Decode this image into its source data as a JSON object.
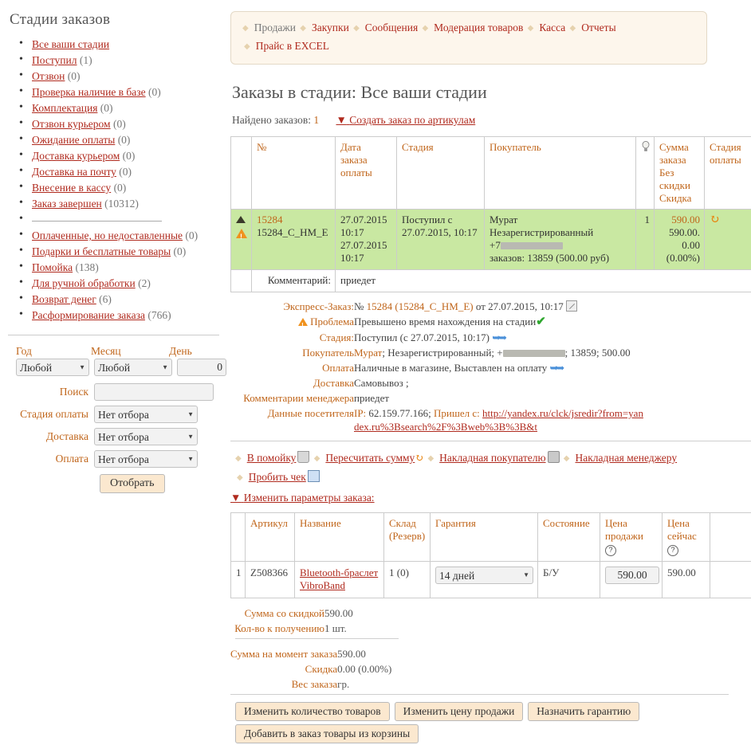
{
  "sidebar": {
    "title": "Стадии заказов",
    "stages": [
      {
        "label": "Все ваши стадии",
        "count": ""
      },
      {
        "label": "Поступил",
        "count": "(1)"
      },
      {
        "label": "Отзвон",
        "count": "(0)"
      },
      {
        "label": "Проверка наличие в базе",
        "count": "(0)"
      },
      {
        "label": "Комплектация",
        "count": "(0)"
      },
      {
        "label": "Отзвон курьером",
        "count": "(0)"
      },
      {
        "label": "Ожидание оплаты",
        "count": "(0)"
      },
      {
        "label": "Доставка курьером",
        "count": "(0)"
      },
      {
        "label": "Доставка на почту",
        "count": "(0)"
      },
      {
        "label": "Внесение в кассу",
        "count": "(0)"
      },
      {
        "label": "Заказ завершен",
        "count": "(10312)"
      }
    ],
    "stages2": [
      {
        "label": "Оплаченные, но недоставленные",
        "count": "(0)"
      },
      {
        "label": "Подарки и бесплатные товары",
        "count": "(0)"
      },
      {
        "label": "Помойка",
        "count": "(138)"
      },
      {
        "label": "Для ручной обработки",
        "count": "(2)"
      },
      {
        "label": "Возврат денег",
        "count": "(6)"
      },
      {
        "label": "Расформирование заказа",
        "count": "(766)"
      }
    ],
    "filter": {
      "year_label": "Год",
      "month_label": "Месяц",
      "day_label": "День",
      "year_value": "Любой",
      "month_value": "Любой",
      "day_value": "0",
      "search_label": "Поиск",
      "search_value": "",
      "search_placeholder": "",
      "pay_stage_label": "Стадия оплаты",
      "pay_stage_value": "Нет отбора",
      "delivery_label": "Доставка",
      "delivery_value": "Нет отбора",
      "payment_label": "Оплата",
      "payment_value": "Нет отбора",
      "submit_label": "Отобрать"
    }
  },
  "topnav": {
    "items": [
      {
        "label": "Продажи",
        "current": true
      },
      {
        "label": "Закупки",
        "current": false
      },
      {
        "label": "Сообщения",
        "current": false
      },
      {
        "label": "Модерация товаров",
        "current": false
      },
      {
        "label": "Касса",
        "current": false
      },
      {
        "label": "Отчеты",
        "current": false
      },
      {
        "label": "Прайс в EXCEL",
        "current": false
      }
    ]
  },
  "main": {
    "page_title": "Заказы в стадии: Все ваши стадии",
    "found_label": "Найдено заказов:",
    "found_count": "1",
    "create_order_link": "Создать заказ по артикулам"
  },
  "orders_table": {
    "headers": {
      "flag": "",
      "num": "№",
      "date": "Дата заказа оплаты",
      "stage": "Стадия",
      "buyer": "Покупатель",
      "bulb": "bulb-icon",
      "sum": "Сумма заказа Без скидки Скидка",
      "pay_stage": "Стадия оплаты"
    },
    "header_lines": {
      "date": [
        "Дата",
        "заказа",
        "оплаты"
      ],
      "sum": [
        "Сумма",
        "заказа",
        "Без",
        "скидки",
        "Скидка"
      ],
      "pay_stage": [
        "Стадия",
        "оплаты"
      ]
    },
    "row": {
      "num": "15284",
      "num_code": "15284_C_HM_E",
      "date_order": "27.07.2015 10:17",
      "date_pay": "27.07.2015 10:17",
      "stage": "Поступил с 27.07.2015, 10:17",
      "buyer_name": "Мурат",
      "buyer_status": "Незарегистрированный",
      "buyer_phone_prefix": "+7",
      "buyer_orders": "заказов: 13859 (500.00 руб)",
      "qty": "1",
      "sum": "590.00",
      "sum_nodisc": "590.00.",
      "discount": "0.00",
      "discount_pct": "(0.00%)"
    },
    "comment_label": "Комментарий:",
    "comment_value": "приедет"
  },
  "detail": {
    "express_label": "Экспресс-Заказ:",
    "express_value_prefix": "№",
    "express_num": "15284",
    "express_code": "(15284_C_HM_E)",
    "express_date": "от 27.07.2015, 10:17",
    "problem_label": "Проблема",
    "problem_value": "Превышено время нахождения на стадии",
    "stage_label": "Стадия:",
    "stage_value": "Поступил (с 27.07.2015, 10:17)",
    "buyer_label": "Покупатель",
    "buyer_name": "Мурат",
    "buyer_rest": "; Незарегистрированный; +",
    "buyer_tail": ";  13859; 500.00",
    "payment_label": "Оплата",
    "payment_value": "Наличные в магазине, Выставлен на оплату",
    "delivery_label": "Доставка",
    "delivery_value": "Самовывоз ;",
    "manager_comment_label": "Комментарии менеджера",
    "manager_comment_value": "приедет",
    "visitor_label": "Данные посетителя",
    "visitor_ip_prefix": "IP:",
    "visitor_ip": "62.159.77.166;",
    "visitor_from_label": "Пришел с:",
    "visitor_url": "http://yandex.ru/clck/jsredir?from=yandex.ru%3Bsearch%2F%3Bweb%3B%3B&t"
  },
  "actions": {
    "links": [
      {
        "label": "В помойку",
        "icon": "trash-icon"
      },
      {
        "label": "Пересчитать сумму",
        "icon": "recalculate-icon"
      },
      {
        "label": "Накладная покупателю",
        "icon": "print-icon"
      },
      {
        "label": "Накладная менеджеру",
        "icon": "print-icon"
      },
      {
        "label": "Пробить чек",
        "icon": "receipt-icon"
      }
    ],
    "change_params": "Изменить параметры заказа:"
  },
  "products_table": {
    "headers": {
      "idx": "",
      "article": "Артикул",
      "name": "Название",
      "sklad": "Склад (Резерв)",
      "sklad_lines": [
        "Склад",
        "(Резерв)"
      ],
      "garant": "Гарантия",
      "sostoyanie": "Состояние",
      "price_sale": "Цена продажи",
      "price_sale_lines": [
        "Цена",
        "продажи"
      ],
      "price_now": "Цена сейчас",
      "price_now_lines": [
        "Цена",
        "сейчас"
      ]
    },
    "rows": [
      {
        "idx": "1",
        "article": "Z508366",
        "name": "Bluetooth-браслет VibroBand",
        "sklad": "1 (0)",
        "garant": "14 дней",
        "sostoyanie": "Б/У",
        "price_sale": "590.00",
        "price_now": "590.00"
      }
    ]
  },
  "totals": {
    "sum_discount_label": "Сумма со скидкой",
    "sum_discount_value": "590.00",
    "qty_label": "Кол-во к получению",
    "qty_value": "1 шт.",
    "sum_moment_label": "Сумма на момент заказа",
    "sum_moment_value": "590.00",
    "discount_label": "Скидка",
    "discount_value": "0.00 (0.00%)",
    "weight_label": "Вес заказа",
    "weight_value": "гр."
  },
  "bottom_buttons": {
    "change_qty": "Изменить количество товаров",
    "change_price": "Изменить цену продажи",
    "assign_warranty": "Назначить гарантию",
    "add_from_cart": "Добавить в заказ товары из корзины"
  },
  "colors": {
    "link_red": "#b02a1e",
    "label_orange": "#c0651a",
    "row_green": "#c9e8a2",
    "nav_bg": "#fdf6ec",
    "button_bg": "#fbe8cf"
  }
}
